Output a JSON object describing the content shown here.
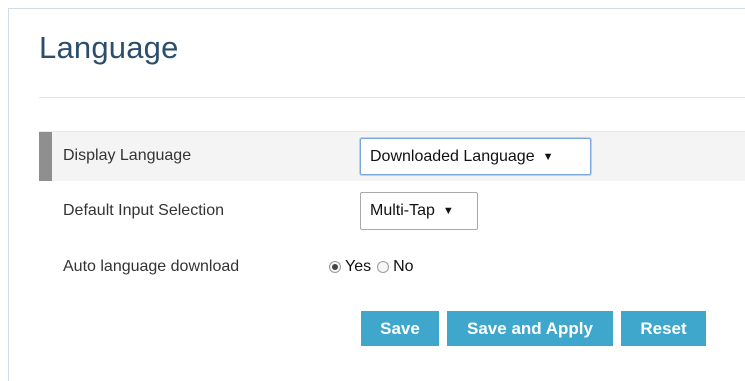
{
  "page": {
    "title": "Language"
  },
  "form": {
    "display_language": {
      "label": "Display Language",
      "value": "Downloaded Language"
    },
    "default_input": {
      "label": "Default Input Selection",
      "value": "Multi-Tap"
    },
    "auto_download": {
      "label": "Auto language download",
      "options": [
        "Yes",
        "No"
      ],
      "selected": "Yes"
    }
  },
  "buttons": {
    "save": "Save",
    "save_apply": "Save and Apply",
    "reset": "Reset"
  },
  "colors": {
    "title": "#2b4e6d",
    "button": "#3fa7cc",
    "row_highlight": "#f4f4f4",
    "row_marker": "#8f8f8f"
  }
}
